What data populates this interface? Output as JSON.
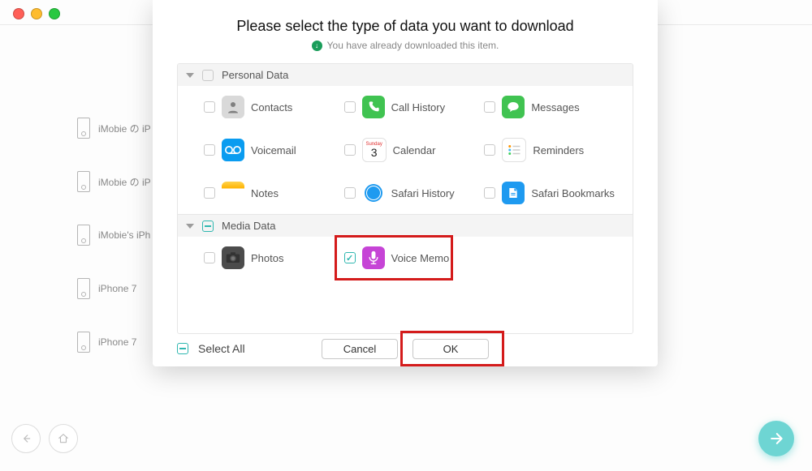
{
  "devices": [
    {
      "label": "iMobie の iP"
    },
    {
      "label": "iMobie の iP"
    },
    {
      "label": "iMobie's iPh"
    },
    {
      "label": "iPhone 7"
    },
    {
      "label": "iPhone 7"
    }
  ],
  "modal": {
    "title": "Please select the type of data you want to download",
    "subtitle": "You have already downloaded this item.",
    "groups": {
      "personal": {
        "label": "Personal Data",
        "items": {
          "contacts": "Contacts",
          "call_history": "Call History",
          "messages": "Messages",
          "voicemail": "Voicemail",
          "calendar": "Calendar",
          "reminders": "Reminders",
          "notes": "Notes",
          "safari_history": "Safari History",
          "safari_bookmarks": "Safari Bookmarks"
        }
      },
      "media": {
        "label": "Media Data",
        "items": {
          "photos": "Photos",
          "voice_memo": "Voice Memo"
        }
      }
    },
    "select_all_label": "Select All",
    "cancel_label": "Cancel",
    "ok_label": "OK"
  },
  "calendar_day": "3",
  "colors": {
    "accent": "#2fb7b0",
    "next_button": "#6ed5d3",
    "highlight": "#d41b1b"
  }
}
